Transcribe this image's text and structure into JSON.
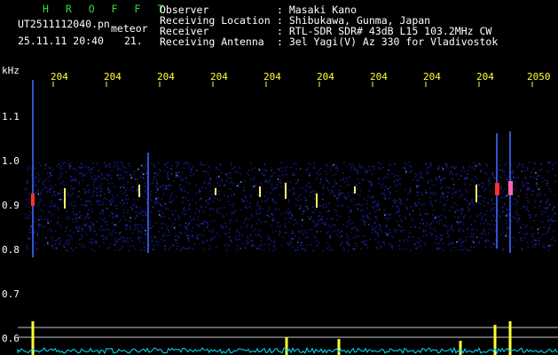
{
  "header": {
    "app_name": "H R O F F T",
    "file": "UT2511112040.pn",
    "type": "meteor",
    "datetime": "25.11.11 20:40",
    "extra": "21.",
    "observer_label": "Observer",
    "observer_value": ": Masaki Kano",
    "location_label": "Receiving Location",
    "location_value": ": Shibukawa, Gunma, Japan",
    "receiver_label": "Receiver",
    "receiver_value": ": RTL-SDR SDR# 43dB L15 103.2MHz CW",
    "antenna_label": "Receiving Antenna",
    "antenna_value": ": 3el Yagi(V) Az 330 for Vladivostok"
  },
  "axis": {
    "unit": "kHz",
    "ticks": [
      "1.1",
      "1.0",
      "0.9",
      "0.8",
      "0.7",
      "0.6"
    ]
  },
  "time_labels": [
    "204",
    "204",
    "204",
    "204",
    "204",
    "204",
    "204",
    "204",
    "204",
    "2050"
  ],
  "colors": {
    "background": "#000000",
    "band": "#1a1aa0",
    "strong": "#ff3030",
    "medium": "#ffff30",
    "level": "#00e0ff"
  }
}
